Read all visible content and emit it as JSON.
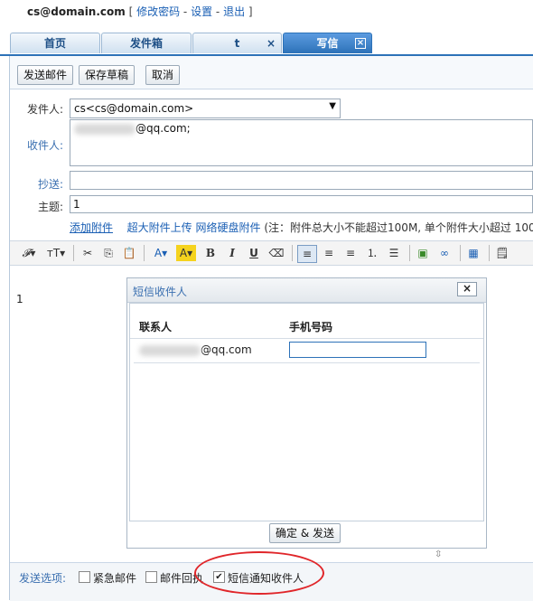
{
  "topbar": {
    "email": "cs@domain.com",
    "bracket_open": " [ ",
    "change_password": "修改密码",
    "dash1": " - ",
    "settings": "设置",
    "dash2": " - ",
    "logout": "退出",
    "bracket_close": " ]"
  },
  "tabs": [
    {
      "label": "首页"
    },
    {
      "label": "发件箱"
    },
    {
      "label": "t",
      "close": "×"
    },
    {
      "label": "写信",
      "close": "×"
    }
  ],
  "toolbar": {
    "send": "发送邮件",
    "save_draft": "保存草稿",
    "cancel": "取消"
  },
  "form": {
    "from_label": "发件人:",
    "from_value": "cs<cs@domain.com>",
    "to_label": "收件人:",
    "to_suffix": "@qq.com;",
    "cc_label": "抄送:",
    "subject_label": "主题:",
    "subject_value": "1",
    "add_attachment": "添加附件",
    "big_attachment": "超大附件上传",
    "netdisk_attachment": "网络硬盘附件",
    "attachment_note": "(注：附件总大小不能超过100M, 单个附件大小超过 100"
  },
  "editor": {
    "body_text": "1"
  },
  "dialog": {
    "title": "短信收件人",
    "close": "×",
    "col_contact": "联系人",
    "col_phone": "手机号码",
    "row_contact_suffix": "@qq.com",
    "row_phone_value": "",
    "confirm_send": "确定 & 发送"
  },
  "bottom": {
    "send_options": "发送选项:",
    "urgent": "紧急邮件",
    "urgent_checked": false,
    "receipt": "邮件回执",
    "receipt_checked": false,
    "sms_notify": "短信通知收件人",
    "sms_notify_checked": true
  },
  "colors": {
    "tab_active": "#2d72b8",
    "link": "#1a5fb4",
    "annotation_circle": "#e0262a"
  }
}
